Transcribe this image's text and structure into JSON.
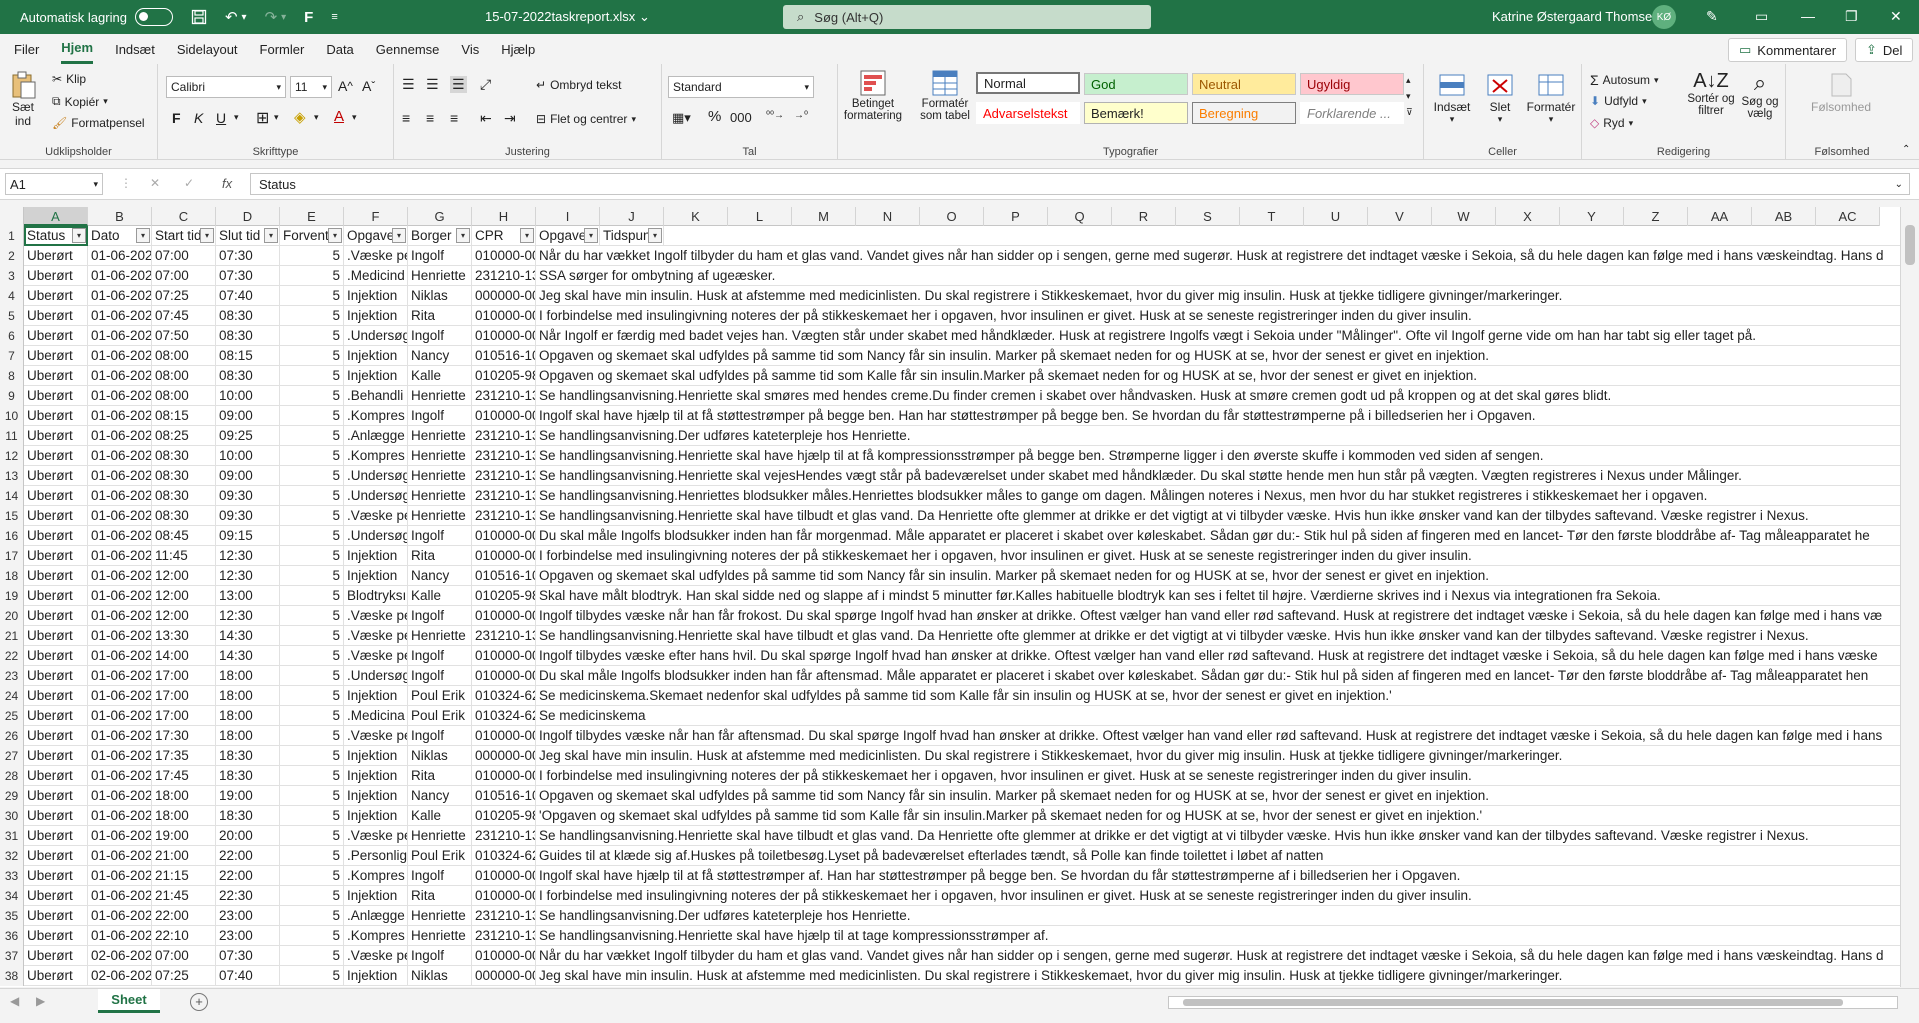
{
  "titlebar": {
    "autosave_label": "Automatisk lagring",
    "filename": "15-07-2022taskreport.xlsx",
    "search_placeholder": "Søg (Alt+Q)",
    "user_name": "Katrine Østergaard Thomsen",
    "user_initials": "KØ"
  },
  "menu": {
    "tabs": [
      "Filer",
      "Hjem",
      "Indsæt",
      "Sidelayout",
      "Formler",
      "Data",
      "Gennemse",
      "Vis",
      "Hjælp"
    ],
    "comments_label": "Kommentarer",
    "share_label": "Del"
  },
  "ribbon": {
    "clipboard": {
      "paste": "Sæt",
      "paste2": "ind",
      "cut": "Klip",
      "copy": "Kopiér",
      "format_painter": "Formatpensel",
      "label": "Udklipsholder"
    },
    "font": {
      "name": "Calibri",
      "size": "11",
      "label": "Skrifttype",
      "bold": "F",
      "italic": "K",
      "underline": "U"
    },
    "alignment": {
      "wrap": "Ombryd tekst",
      "merge": "Flet og centrer",
      "label": "Justering"
    },
    "number": {
      "format": "Standard",
      "label": "Tal"
    },
    "styles": {
      "conditional": "Betinget",
      "conditional2": "formatering",
      "as_table": "Formatér",
      "as_table2": "som tabel",
      "label": "Typografier",
      "normal": "Normal",
      "good": "God",
      "neutral": "Neutral",
      "bad": "Ugyldig",
      "warning": "Advarselstekst",
      "note": "Bemærk!",
      "calc": "Beregning",
      "explanatory": "Forklarende ..."
    },
    "cells": {
      "insert": "Indsæt",
      "delete": "Slet",
      "format": "Formatér",
      "label": "Celler"
    },
    "editing": {
      "autosum": "Autosum",
      "fill": "Udfyld",
      "clear": "Ryd",
      "sort": "Sortér og",
      "sort2": "filtrer",
      "find": "Søg og",
      "find2": "vælg",
      "label": "Redigering"
    },
    "sensitivity": {
      "btn": "Følsomhed",
      "label": "Følsomhed"
    }
  },
  "formula": {
    "namebox": "A1",
    "fx": "fx",
    "content": "Status"
  },
  "columns": [
    "A",
    "B",
    "C",
    "D",
    "E",
    "F",
    "G",
    "H",
    "I",
    "J",
    "K",
    "L",
    "M",
    "N",
    "O",
    "P",
    "Q",
    "R",
    "S",
    "T",
    "U",
    "V",
    "W",
    "X",
    "Y",
    "Z",
    "AA",
    "AB",
    "AC"
  ],
  "headers": [
    "Status",
    "Dato",
    "Start tid",
    "Slut tid",
    "Forventet",
    "Opgave",
    "Borger",
    "CPR",
    "Opgave",
    "Tidspunkt"
  ],
  "rows": [
    [
      "Uberørt",
      "01-06-2022",
      "07:00",
      "07:30",
      "5",
      ".Væske pe",
      "Ingolf",
      "010000-00",
      "Når du har vækket Ingolf tilbyder du ham et glas vand. Vandet gives når han sidder op i sengen, gerne med sugerør. Husk at registrere det indtaget væske i Sekoia, så du hele dagen kan følge med i hans væskeindtag. Hans d"
    ],
    [
      "Uberørt",
      "01-06-2022",
      "07:00",
      "07:30",
      "5",
      ".Medicind",
      "Henriette",
      "231210-13",
      "SSA sørger for ombytning af ugeæsker."
    ],
    [
      "Uberørt",
      "01-06-2022",
      "07:25",
      "07:40",
      "5",
      "Injektion",
      "Niklas",
      "000000-00",
      "Jeg skal have min insulin. Husk at afstemme med medicinlisten. Du skal registrere i Stikkeskemaet, hvor du giver mig insulin. Husk at tjekke tidligere givninger/markeringer."
    ],
    [
      "Uberørt",
      "01-06-2022",
      "07:45",
      "08:30",
      "5",
      "Injektion",
      "Rita",
      "010000-00",
      "I forbindelse med insulingivning noteres der på stikkeskemaet her i opgaven, hvor insulinen er givet. Husk at se seneste registreringer inden du giver insulin."
    ],
    [
      "Uberørt",
      "01-06-2022",
      "07:50",
      "08:30",
      "5",
      ".Undersøg",
      "Ingolf",
      "010000-00",
      "Når Ingolf er færdig med badet vejes han. Vægten står under skabet med håndklæder. Husk at registrere Ingolfs vægt i Sekoia under \"Målinger\". Ofte vil Ingolf gerne vide om han har tabt sig eller taget på."
    ],
    [
      "Uberørt",
      "01-06-2022",
      "08:00",
      "08:15",
      "5",
      "Injektion",
      "Nancy",
      "010516-10",
      "Opgaven og  skemaet skal udfyldes på samme tid som Nancy får sin insulin. Marker på skemaet neden for og HUSK at se, hvor der senest er givet en injektion."
    ],
    [
      "Uberørt",
      "01-06-2022",
      "08:00",
      "08:30",
      "5",
      "Injektion",
      "Kalle",
      "010205-98",
      "Opgaven og skemaet skal udfyldes på samme tid som Kalle får sin insulin.Marker på skemaet neden for og HUSK at se, hvor der senest er givet en injektion."
    ],
    [
      "Uberørt",
      "01-06-2022",
      "08:00",
      "10:00",
      "5",
      ".Behandli",
      "Henriette",
      "231210-13",
      "Se handlingsanvisning.Henriette skal smøres med hendes creme.Du finder cremen i skabet over håndvasken. Husk at smøre cremen godt ud på kroppen og at det skal gøres blidt."
    ],
    [
      "Uberørt",
      "01-06-2022",
      "08:15",
      "09:00",
      "5",
      ".Kompres",
      "Ingolf",
      "010000-00",
      "Ingolf skal have hjælp til at få støttestrømper på begge ben. Han har støttestrømper på begge ben. Se hvordan du får støttestrømperne på i billedserien her i Opgaven."
    ],
    [
      "Uberørt",
      "01-06-2022",
      "08:25",
      "09:25",
      "5",
      ".Anlægge",
      "Henriette",
      "231210-13",
      "Se handlingsanvisning.Der udføres kateterpleje hos Henriette."
    ],
    [
      "Uberørt",
      "01-06-2022",
      "08:30",
      "10:00",
      "5",
      ".Kompres",
      "Henriette",
      "231210-13",
      "Se handlingsanvisning.Henriette skal have hjælp til at få kompressionsstrømper på begge ben. Strømperne ligger i den øverste skuffe i kommoden ved siden af sengen."
    ],
    [
      "Uberørt",
      "01-06-2022",
      "08:30",
      "09:00",
      "5",
      ".Undersøg",
      "Henriette",
      "231210-13",
      "Se handlingsanvisning.Henriette skal vejesHendes vægt står på badeværelset under skabet med håndklæder. Du skal støtte hende men hun står på vægten. Vægten registreres i Nexus under Målinger."
    ],
    [
      "Uberørt",
      "01-06-2022",
      "08:30",
      "09:30",
      "5",
      ".Undersøg",
      "Henriette",
      "231210-13",
      "Se handlingsanvisning.Henriettes blodsukker måles.Henriettes blodsukker måles to gange om dagen. Målingen noteres i Nexus, men hvor du har stukket registreres i stikkeskemaet her i opgaven."
    ],
    [
      "Uberørt",
      "01-06-2022",
      "08:30",
      "09:30",
      "5",
      ".Væske pe",
      "Henriette",
      "231210-13",
      "Se handlingsanvisning.Henriette skal have tilbudt et glas vand. Da Henriette ofte glemmer at drikke er det vigtigt at vi tilbyder væske. Hvis hun ikke ønsker vand kan der tilbydes saftevand. Væske registrer i Nexus."
    ],
    [
      "Uberørt",
      "01-06-2022",
      "08:45",
      "09:15",
      "5",
      ".Undersøg",
      "Ingolf",
      "010000-00",
      "Du skal måle Ingolfs blodsukker inden han får morgenmad. Måle apparatet er placeret i skabet over køleskabet. Sådan gør du:- Stik hul på siden af fingeren med en lancet- Tør den første bloddråbe af- Tag måleapparatet he"
    ],
    [
      "Uberørt",
      "01-06-2022",
      "11:45",
      "12:30",
      "5",
      "Injektion",
      "Rita",
      "010000-00",
      "I forbindelse med insulingivning noteres der på stikkeskemaet her i opgaven, hvor insulinen er givet. Husk at se seneste registreringer inden du giver insulin."
    ],
    [
      "Uberørt",
      "01-06-2022",
      "12:00",
      "12:30",
      "5",
      "Injektion",
      "Nancy",
      "010516-10",
      "Opgaven og  skemaet skal udfyldes på samme tid som Nancy får sin insulin. Marker på skemaet neden for og HUSK at se, hvor der senest er givet en injektion."
    ],
    [
      "Uberørt",
      "01-06-2022",
      "12:00",
      "13:00",
      "5",
      "Blodtryksı",
      "Kalle",
      "010205-98",
      "Skal have målt blodtryk. Han skal sidde ned og slappe af i mindst 5 minutter før.Kalles habituelle blodtryk kan ses i feltet til højre. Værdierne skrives ind i Nexus via integrationen fra Sekoia."
    ],
    [
      "Uberørt",
      "01-06-2022",
      "12:00",
      "12:30",
      "5",
      ".Væske pe",
      "Ingolf",
      "010000-00",
      "Ingolf tilbydes væske når han får frokost. Du skal spørge Ingolf hvad han ønsker at drikke. Oftest vælger han vand eller rød saftevand. Husk at registrere det indtaget væske i Sekoia, så du hele dagen kan følge med i hans væ"
    ],
    [
      "Uberørt",
      "01-06-2022",
      "13:30",
      "14:30",
      "5",
      ".Væske pe",
      "Henriette",
      "231210-13",
      "Se handlingsanvisning.Henriette skal have tilbudt et glas vand. Da Henriette ofte glemmer at drikke er det vigtigt at vi tilbyder væske. Hvis hun ikke ønsker vand kan der tilbydes saftevand. Væske registrer i Nexus."
    ],
    [
      "Uberørt",
      "01-06-2022",
      "14:00",
      "14:30",
      "5",
      ".Væske pe",
      "Ingolf",
      "010000-00",
      "Ingolf tilbydes væske efter hans hvil. Du skal spørge Ingolf hvad han ønsker at drikke. Oftest vælger han vand eller rød saftevand. Husk at registrere det indtaget væske i Sekoia, så du hele dagen kan følge med i hans væske"
    ],
    [
      "Uberørt",
      "01-06-2022",
      "17:00",
      "18:00",
      "5",
      ".Undersøg",
      "Ingolf",
      "010000-00",
      "Du skal måle Ingolfs blodsukker inden han får aftensmad. Måle apparatet er placeret i skabet over køleskabet. Sådan gør du:- Stik hul på siden af fingeren med en lancet- Tør den første bloddråbe af- Tag måleapparatet hen"
    ],
    [
      "Uberørt",
      "01-06-2022",
      "17:00",
      "18:00",
      "5",
      "Injektion",
      "Poul Erik",
      "010324-62",
      "Se medicinskema.Skemaet nedenfor skal udfyldes på samme tid som Kalle får sin insulin og HUSK at se, hvor der senest er givet en injektion.'"
    ],
    [
      "Uberørt",
      "01-06-2022",
      "17:00",
      "18:00",
      "5",
      ".Medicina",
      "Poul Erik",
      "010324-62",
      "Se medicinskema"
    ],
    [
      "Uberørt",
      "01-06-2022",
      "17:30",
      "18:00",
      "5",
      ".Væske pe",
      "Ingolf",
      "010000-00",
      "Ingolf tilbydes væske når han får aftensmad. Du skal spørge Ingolf hvad han ønsker at drikke. Oftest vælger han vand eller rød saftevand. Husk at registrere det indtaget væske i Sekoia, så du hele dagen kan følge med i hans"
    ],
    [
      "Uberørt",
      "01-06-2022",
      "17:35",
      "18:30",
      "5",
      "Injektion",
      "Niklas",
      "000000-00",
      "Jeg skal have min insulin. Husk at afstemme med medicinlisten. Du skal registrere i Stikkeskemaet, hvor du giver mig insulin. Husk at tjekke tidligere givninger/markeringer."
    ],
    [
      "Uberørt",
      "01-06-2022",
      "17:45",
      "18:30",
      "5",
      "Injektion",
      "Rita",
      "010000-00",
      "I forbindelse med insulingivning noteres der på stikkeskemaet her i opgaven, hvor insulinen er givet. Husk at se seneste registreringer inden du giver insulin."
    ],
    [
      "Uberørt",
      "01-06-2022",
      "18:00",
      "19:00",
      "5",
      "Injektion",
      "Nancy",
      "010516-10",
      "Opgaven og  skemaet skal udfyldes på samme tid som Nancy får sin insulin. Marker på skemaet neden for og HUSK at se, hvor der senest er givet en injektion."
    ],
    [
      "Uberørt",
      "01-06-2022",
      "18:00",
      "18:30",
      "5",
      "Injektion",
      "Kalle",
      "010205-98",
      "'Opgaven og skemaet skal udfyldes på samme tid som Kalle får sin insulin.Marker på skemaet neden for og HUSK at se, hvor der senest er givet en injektion.'"
    ],
    [
      "Uberørt",
      "01-06-2022",
      "19:00",
      "20:00",
      "5",
      ".Væske pe",
      "Henriette",
      "231210-13",
      "Se handlingsanvisning.Henriette skal have tilbudt et glas vand. Da Henriette ofte glemmer at drikke er det vigtigt at vi tilbyder væske. Hvis hun ikke ønsker vand kan der tilbydes saftevand. Væske registrer i Nexus."
    ],
    [
      "Uberørt",
      "01-06-2022",
      "21:00",
      "22:00",
      "5",
      ".Personlig",
      "Poul Erik",
      "010324-62",
      "Guides til at klæde sig af.Huskes på toiletbesøg.Lyset på badeværelset efterlades tændt, så Polle kan finde toilettet i løbet af natten"
    ],
    [
      "Uberørt",
      "01-06-2022",
      "21:15",
      "22:00",
      "5",
      ".Kompres",
      "Ingolf",
      "010000-00",
      "Ingolf skal have hjælp til at få støttestrømper af. Han har støttestrømper på begge ben. Se hvordan du får støttestrømperne af i billedserien her i Opgaven."
    ],
    [
      "Uberørt",
      "01-06-2022",
      "21:45",
      "22:30",
      "5",
      "Injektion",
      "Rita",
      "010000-00",
      "I forbindelse med insulingivning noteres der på stikkeskemaet her i opgaven, hvor insulinen er givet. Husk at se seneste registreringer inden du giver insulin."
    ],
    [
      "Uberørt",
      "01-06-2022",
      "22:00",
      "23:00",
      "5",
      ".Anlægge",
      "Henriette",
      "231210-13",
      "Se handlingsanvisning.Der udføres kateterpleje hos Henriette."
    ],
    [
      "Uberørt",
      "01-06-2022",
      "22:10",
      "23:00",
      "5",
      ".Kompres",
      "Henriette",
      "231210-13",
      "Se handlingsanvisning.Henriette skal have hjælp til at tage kompressionsstrømper af."
    ],
    [
      "Uberørt",
      "02-06-2022",
      "07:00",
      "07:30",
      "5",
      ".Væske pe",
      "Ingolf",
      "010000-00",
      "Når du har vækket Ingolf tilbyder du ham et glas vand. Vandet gives når han sidder op i sengen, gerne med sugerør. Husk at registrere det indtaget væske i Sekoia, så du hele dagen kan følge med i hans væskeindtag. Hans d"
    ],
    [
      "Uberørt",
      "02-06-2022",
      "07:25",
      "07:40",
      "5",
      "Injektion",
      "Niklas",
      "000000-00",
      "Jeg skal have min insulin. Husk at afstemme med medicinlisten. Du skal registrere i Stikkeskemaet, hvor du giver mig insulin. Husk at tjekke tidligere givninger/markeringer."
    ]
  ],
  "sheet": {
    "name": "Sheet"
  }
}
